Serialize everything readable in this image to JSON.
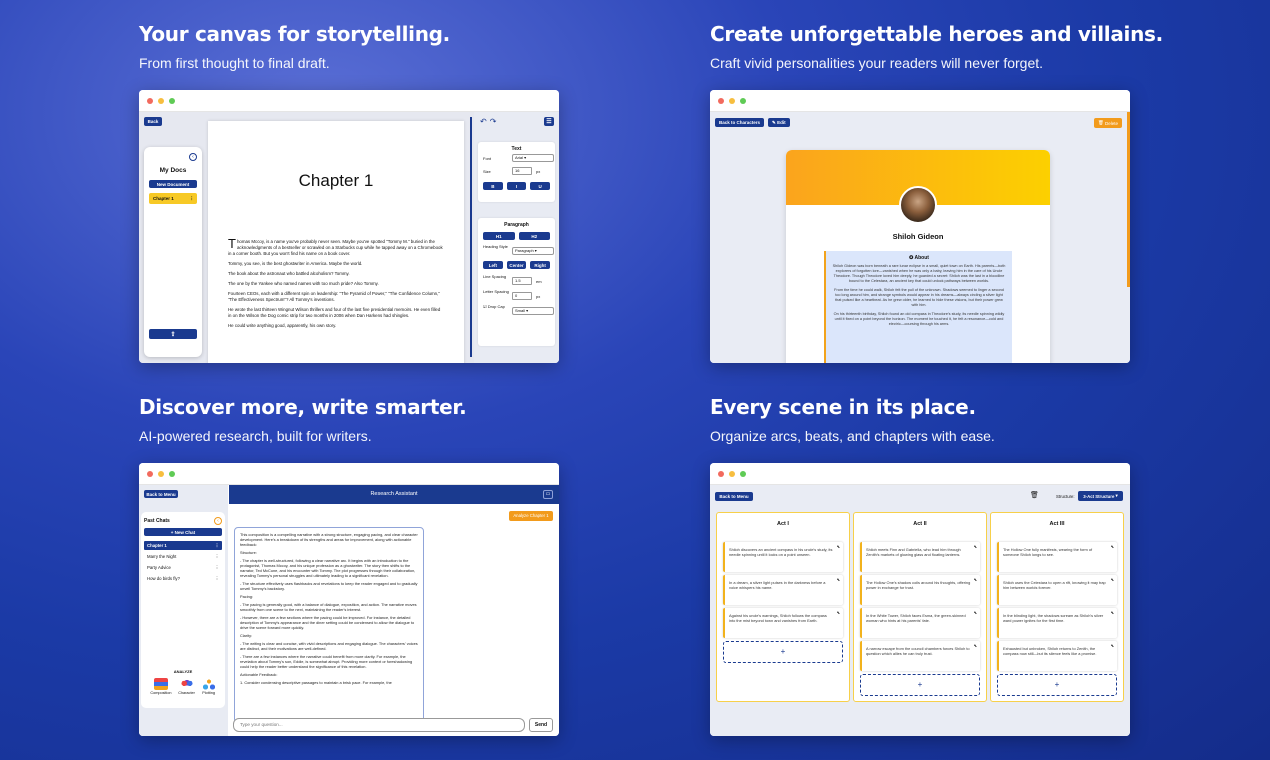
{
  "features": {
    "storytelling": {
      "title": "Your canvas for storytelling.",
      "subtitle": "From first thought to final draft.",
      "editor": {
        "back": "Back",
        "sidebar_title": "My Docs",
        "new_document": "New Document",
        "doc_item": "Chapter 1",
        "chapter_heading": "Chapter 1",
        "paragraphs": [
          "Thomas Mccoy, is a name you've probably never seen. Maybe you've spotted \"Tommy M.\" buried in the acknowledgments of a bestseller or scrawled on a Starbucks cup while he tapped away on a Chromebook in a corner booth. But you won't find his name on a book cover.",
          "Tommy, you see, is the best ghostwriter in America. Maybe the world.",
          "The book about the astronaut who battled alcoholism? Tommy.",
          "The one by the Yankee who named names with too much pride? Also Tommy.",
          "Fourteen CEOs, each with a different spin on leadership: \"The Pyramid of Power,\" \"The Confidence Column,\" \"The Effectiveness Spectrum\"? All Tommy's inventions.",
          "He wrote the last thirteen Wingnut Wilson thrillers and four of the last five presidential memoirs. He even filled in on the Wilson the Dog comic strip for two months in 2006 when Dan Harkens had shingles.",
          "He could write anything good, apparently, his own story."
        ],
        "text_panel": {
          "title": "Text",
          "font_label": "Font",
          "font_value": "Arial",
          "size_label": "Size",
          "size_value": "16",
          "size_unit": "px",
          "bold": "B",
          "italic": "I",
          "underline": "U"
        },
        "paragraph_panel": {
          "title": "Paragraph",
          "h1": "H1",
          "h2": "H2",
          "heading_style_label": "Heading Style",
          "heading_style_value": "Paragraph",
          "left": "Left",
          "center": "Center",
          "right": "Right",
          "line_spacing_label": "Line Spacing",
          "line_spacing_value": "1.5",
          "line_spacing_unit": "em",
          "letter_spacing_label": "Letter Spacing",
          "letter_spacing_value": "0",
          "letter_spacing_unit": "px",
          "drop_cap_label": "Drop Cap",
          "drop_cap_value": "Small"
        }
      }
    },
    "characters": {
      "title": "Create unforgettable heroes and villains.",
      "subtitle": "Craft vivid personalities your readers will never forget.",
      "app": {
        "back": "Back to Characters",
        "edit": "Edit",
        "delete": "Delete",
        "name": "Shiloh Gideon",
        "about_title": "About",
        "about": [
          "Shiloh Gideon was born beneath a rare lunar eclipse in a small, quiet town on Earth. His parents—both explorers of forgotten lore—vanished when he was only a baby, leaving him in the care of his Uncle Theodore. Though Theodore loved him deeply, he guarded a secret: Shiloh was the last in a bloodline bound to the Celestara, an ancient key that could unlock pathways between worlds.",
          "From the time he could walk, Shiloh felt the pull of the unknown. Shadows seemed to linger a second too long around him, and strange symbols would appear in his dreams—always circling a silver light that pulsed like a heartbeat. As he grew older, he learned to hide these visions, but their power grew with him.",
          "On his thirteenth birthday, Shiloh found an old compass in Theodore's study, its needle spinning wildly until it fixed on a point beyond the horizon. The moment he touched it, he felt a resonance—cold and electric—coursing through his arms."
        ]
      }
    },
    "research": {
      "title": "Discover more, write smarter.",
      "subtitle": "AI-powered research, built for writers.",
      "app": {
        "back": "Back to Menu",
        "past_chats": "Past Chats",
        "new_chat": "+ New Chat",
        "chats": [
          "Chapter 1",
          "Marry the Night",
          "Party Advice",
          "How do birds fly?"
        ],
        "analyze_label": "ANALYZE",
        "tools": [
          "Composition",
          "Character",
          "Plotting"
        ],
        "header": "Research Assistant",
        "analyze_button": "Analyze Chapter 1",
        "message": [
          "This composition is a compelling narrative with a strong structure, engaging pacing, and clear character development. Here's a breakdown of its strengths and areas for improvement, along with actionable feedback:",
          "Structure:",
          "- The chapter is well-structured, following a clear narrative arc. It begins with an introduction to the protagonist, Thomas Mccoy, and his unique profession as a ghostwriter. The story then shifts to the narrator, Ted McCune, and his encounter with Tommy. The plot progresses through their collaboration, revealing Tommy's personal struggles and ultimately leading to a significant revelation.",
          "- The structure effectively uses flashbacks and revelations to keep the reader engaged and to gradually unveil Tommy's backstory.",
          "Pacing:",
          "- The pacing is generally good, with a balance of dialogue, exposition, and action. The narrative moves smoothly from one scene to the next, maintaining the reader's interest.",
          "- However, there are a few sections where the pacing could be improved. For instance, the detailed description of Tommy's appearance and the diner setting could be condensed to allow the dialogue to drive the scene forward more quickly.",
          "Clarity:",
          "- The writing is clear and concise, with vivid descriptions and engaging dialogue. The characters' voices are distinct, and their motivations are well-defined.",
          "- There are a few instances where the narrative could benefit from more clarity. For example, the revelation about Tommy's son, Eddie, is somewhat abrupt. Providing more context or foreshadowing could help the reader better understand the significance of this revelation.",
          "Actionable Feedback:",
          "1. Consider condensing descriptive passages to maintain a brisk pace. For example, the"
        ],
        "input_placeholder": "Type your question...",
        "send": "Send"
      }
    },
    "structure": {
      "title": "Every scene in its place.",
      "subtitle": "Organize arcs, beats, and chapters with ease.",
      "app": {
        "back": "Back to Menu",
        "structure_label": "Structure:",
        "structure_value": "3-Act Structure",
        "columns": [
          {
            "title": "Act I",
            "beats": [
              "Shiloh discovers an ancient compass in his uncle's study, its needle spinning until it locks on a point unseen.",
              "In a dream, a silver light pulses in the darkness before a voice whispers his name.",
              "Against his uncle's warnings, Shiloh follows the compass into the mist beyond town and vanishes from Earth."
            ]
          },
          {
            "title": "Act II",
            "beats": [
              "Shiloh meets Finn and Gabriella, who lead him through Zenith's markets of glowing glass and floating lanterns.",
              "The Hollow One's shadow coils around his thoughts, offering power in exchange for trust.",
              "In the White Tower, Shiloh faces Esma, the green-skinned woman who hints at his parents' fate.",
              "A narrow escape from the council chambers forces Shiloh to question which allies he can truly trust."
            ]
          },
          {
            "title": "Act III",
            "beats": [
              "The Hollow One fully manifests, wearing the form of someone Shiloh longs to see.",
              "Shiloh uses the Celestara to open a rift, knowing it may trap him between worlds forever.",
              "In the blinding light, the shadows scream as Shiloh's silver ward power ignites for the first time.",
              "Exhausted but unbroken, Shiloh returns to Zenith, the compass now still—but its silence feels like a promise."
            ]
          }
        ],
        "add": "+"
      }
    }
  },
  "colors": {
    "navy": "#1a3a8f",
    "accent_orange": "#f29b1c",
    "accent_yellow": "#f7c926"
  }
}
